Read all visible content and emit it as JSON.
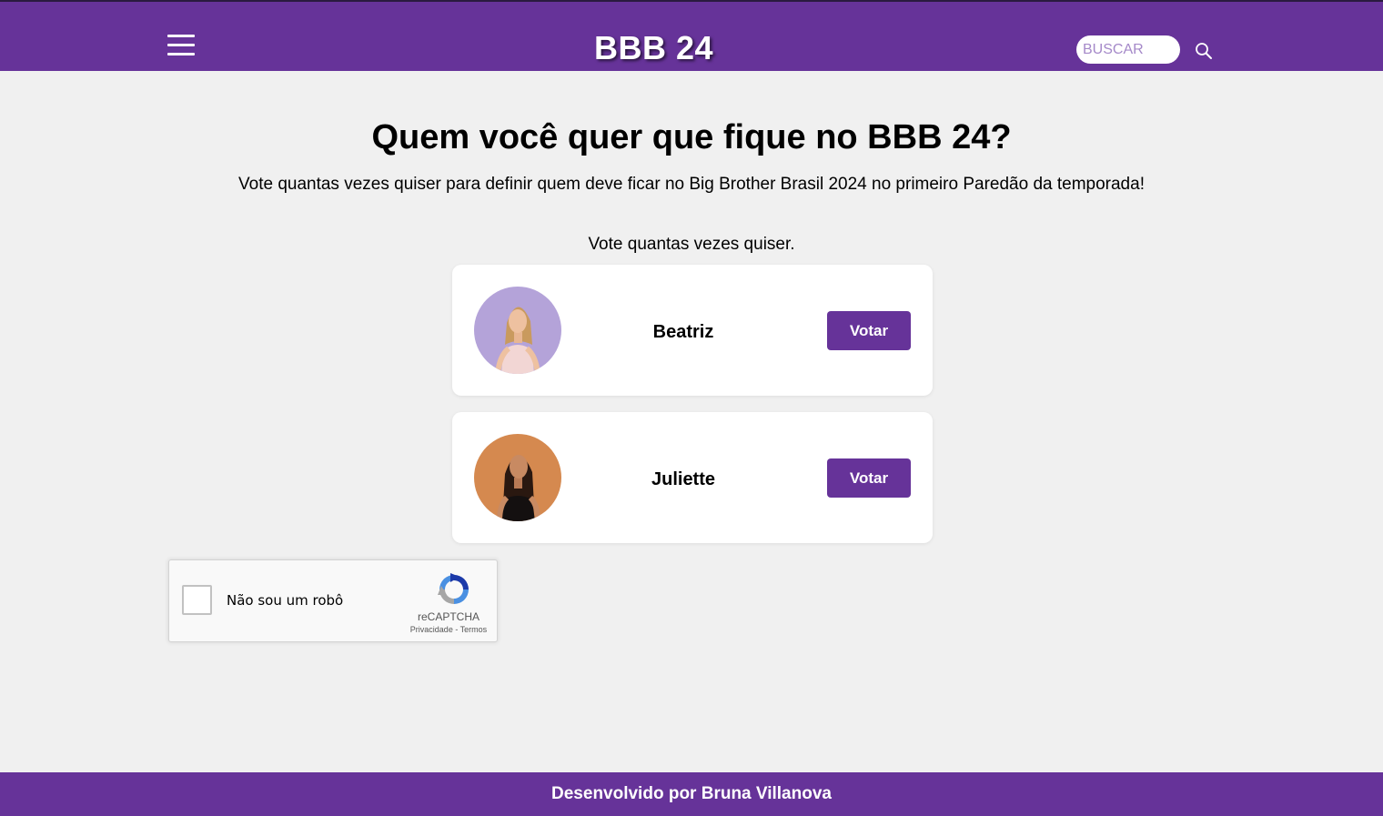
{
  "header": {
    "logo": "BBB 24",
    "search_placeholder": "BUSCAR",
    "menu_icon": "hamburger-menu-icon",
    "search_icon": "search-icon"
  },
  "main": {
    "title": "Quem você quer que fique no BBB 24?",
    "subtitle": "Vote quantas vezes quiser para definir quem deve ficar no Big Brother Brasil 2024 no primeiro Paredão da temporada!",
    "vote_hint": "Vote quantas vezes quiser.",
    "candidates": [
      {
        "name": "Beatriz",
        "button_label": "Votar",
        "photo_bg": "#b4a3d9"
      },
      {
        "name": "Juliette",
        "button_label": "Votar",
        "photo_bg": "#d5894f"
      }
    ]
  },
  "recaptcha": {
    "label": "Não sou um robô",
    "brand": "reCAPTCHA",
    "privacy": "Privacidade",
    "separator": " - ",
    "terms": "Termos"
  },
  "footer": {
    "text": "Desenvolvido por Bruna Villanova"
  },
  "colors": {
    "brand": "#663399",
    "background": "#f0f0f0"
  }
}
